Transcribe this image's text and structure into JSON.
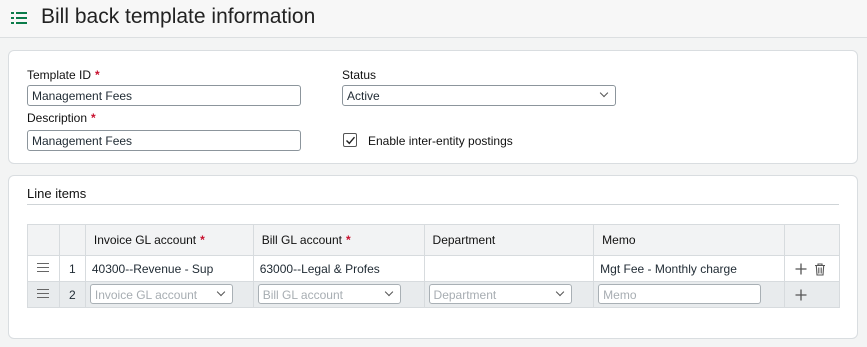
{
  "header": {
    "title": "Bill back template information"
  },
  "form": {
    "template_id": {
      "label": "Template ID",
      "required_mark": "*",
      "value": "Management Fees"
    },
    "description": {
      "label": "Description",
      "required_mark": "*",
      "value": "Management Fees"
    },
    "status": {
      "label": "Status",
      "value": "Active"
    },
    "inter_entity": {
      "label": "Enable inter-entity postings",
      "checked": true
    }
  },
  "line_items": {
    "title": "Line items",
    "columns": [
      {
        "label": "",
        "required": ""
      },
      {
        "label": "",
        "required": ""
      },
      {
        "label": "Invoice GL account",
        "required": "*"
      },
      {
        "label": "Bill GL account",
        "required": "*"
      },
      {
        "label": "Department",
        "required": ""
      },
      {
        "label": "Memo",
        "required": ""
      },
      {
        "label": "",
        "required": ""
      }
    ],
    "rows": [
      {
        "num": "1",
        "invoice_gl": "40300--Revenue - Sup",
        "bill_gl": "63000--Legal & Profes",
        "department": "",
        "memo": "Mgt Fee - Monthly charge"
      },
      {
        "num": "2",
        "invoice_gl_placeholder": "Invoice GL account",
        "bill_gl_placeholder": "Bill GL account",
        "department_placeholder": "Department",
        "memo_placeholder": "Memo"
      }
    ]
  },
  "icons": [
    "menu-list-icon",
    "checkmark-icon",
    "drag-handle-icon",
    "plus-icon",
    "trash-icon",
    "chevron-down-icon"
  ],
  "colors": {
    "accent": "#0a7c4a",
    "required": "#c8102e"
  }
}
